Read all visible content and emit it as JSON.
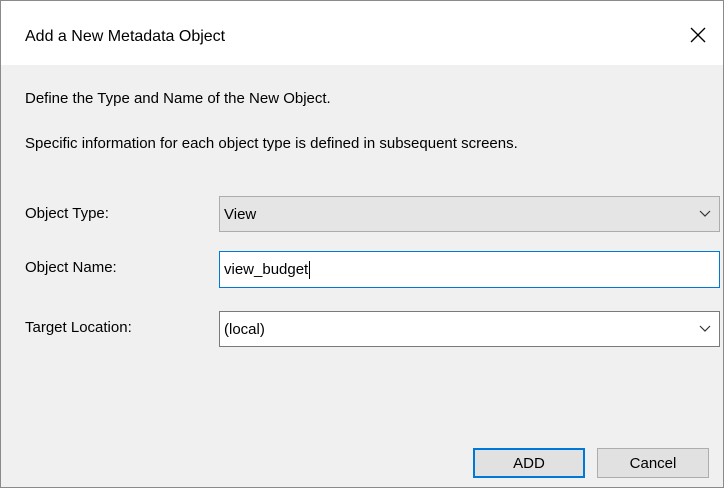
{
  "dialog": {
    "title": "Add a New Metadata Object",
    "description_line1": "Define the Type and Name of the New Object.",
    "description_line2": "Specific information for each object type is defined in subsequent screens."
  },
  "form": {
    "object_type": {
      "label": "Object Type:",
      "value": "View"
    },
    "object_name": {
      "label": "Object Name:",
      "value": "view_budget"
    },
    "target_location": {
      "label": "Target Location:",
      "value": "(local)"
    }
  },
  "buttons": {
    "add_label": "ADD",
    "cancel_label": "Cancel"
  },
  "icons": {
    "close": "close-icon",
    "dropdown": "chevron-down-icon"
  },
  "colors": {
    "accent": "#0078d7",
    "dialog_bg": "#f0f0f0",
    "button_bg": "#e1e1e1"
  }
}
